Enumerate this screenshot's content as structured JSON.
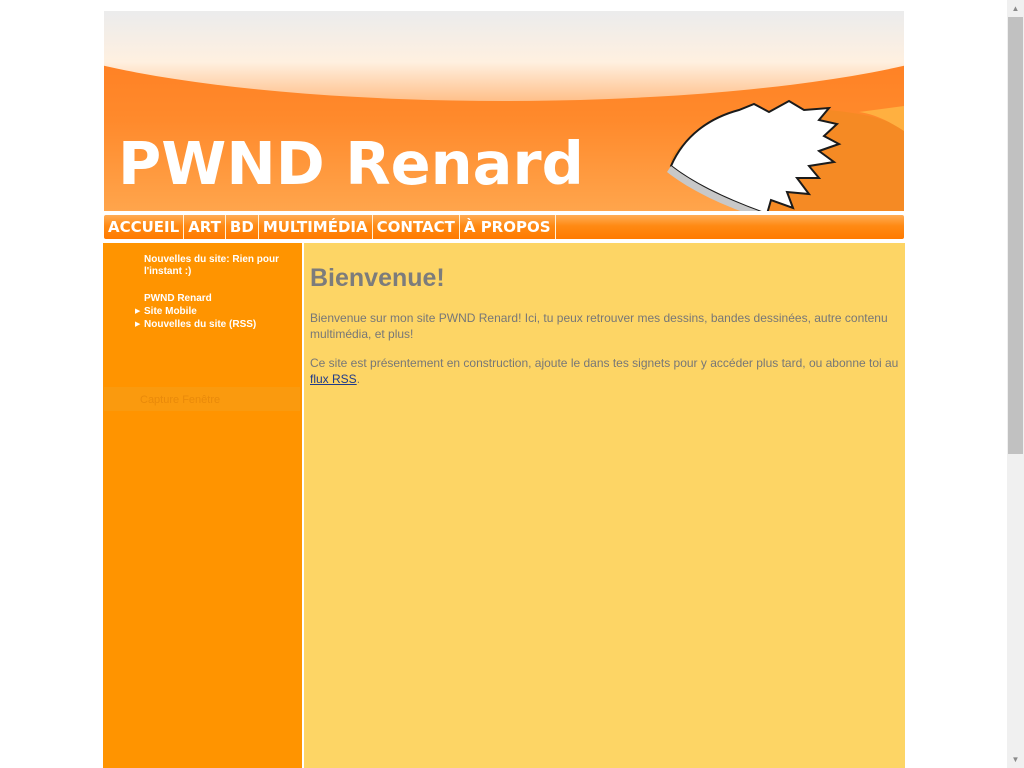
{
  "header": {
    "site_title": "PWND Renard",
    "colors": {
      "orange": "#ff7a1e",
      "light_orange": "#ffa54c"
    }
  },
  "nav": {
    "items": [
      {
        "label": "ACCUEIL"
      },
      {
        "label": "ART"
      },
      {
        "label": "BD"
      },
      {
        "label": "MULTIMÉDIA"
      },
      {
        "label": "CONTACT"
      },
      {
        "label": "À PROPOS"
      }
    ]
  },
  "sidebar": {
    "news": "Nouvelles du site: Rien pour l'instant :)",
    "links_heading": "PWND Renard",
    "links": [
      {
        "label": "Site Mobile",
        "icon": "arrow-right-icon"
      },
      {
        "label": "Nouvelles du site (RSS)",
        "icon": "arrow-right-icon"
      }
    ],
    "capture_label": "Capture Fenêtre",
    "color": "#ff9400"
  },
  "content": {
    "heading": "Bienvenue!",
    "paragraph1": "Bienvenue sur mon site PWND Renard! Ici, tu peux retrouver mes dessins, bandes dessinées, autre contenu multimédia, et plus!",
    "paragraph2_before": "Ce site est présentement en construction, ajoute le dans tes signets pour y accéder plus tard, ou abonne toi au ",
    "rss_link": "flux RSS",
    "paragraph2_after": ".",
    "color": "#fdd565"
  },
  "scrollbar": {
    "up_icon": "arrow-up-icon",
    "down_icon": "arrow-down-icon"
  }
}
